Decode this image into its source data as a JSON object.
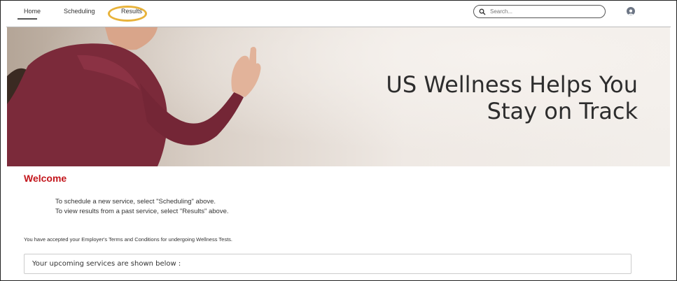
{
  "nav": {
    "home": "Home",
    "scheduling": "Scheduling",
    "results": "Results"
  },
  "search": {
    "placeholder": "Search..."
  },
  "hero": {
    "title_line1": "US Wellness Helps You",
    "title_line2": "Stay on Track"
  },
  "welcome": {
    "heading": "Welcome",
    "line1": "To schedule a new service, select \"Scheduling\" above.",
    "line2": "To view results from a past service, select \"Results\" above."
  },
  "terms": "You have accepted your Employer's Terms and Conditions for undergoing Wellness Tests.",
  "services": {
    "label": "Your upcoming services are shown below :"
  },
  "colors": {
    "accent": "#c3161c",
    "highlight": "#e8b33b"
  }
}
